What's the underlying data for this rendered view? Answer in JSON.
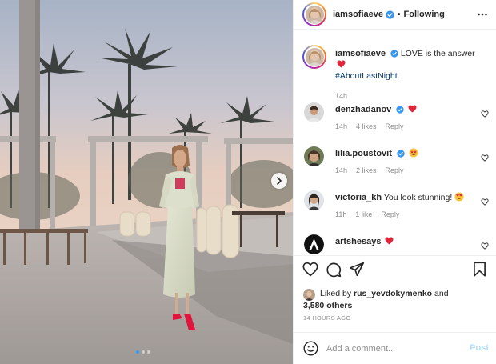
{
  "post": {
    "author": "iamsofiaeve",
    "separator": "•",
    "follow_status": "Following",
    "caption": {
      "text": "LOVE is the answer",
      "hashtag": "#AboutLastNight",
      "time": "14h"
    },
    "carousel": {
      "slides": 3,
      "current": 1
    },
    "likes": {
      "prefix": "Liked by",
      "user": "rus_yevdokymenko",
      "joiner": "and",
      "others": "3,580 others"
    },
    "timestamp": "14 HOURS AGO",
    "add_comment_placeholder": "Add a comment...",
    "post_label": "Post"
  },
  "comments": [
    {
      "user": "denzhadanov",
      "text": "",
      "emoji": "red-heart",
      "time": "14h",
      "likes": "4 likes",
      "reply": "Reply"
    },
    {
      "user": "lilia.poustovit",
      "text": "",
      "emoji": "star-struck",
      "time": "14h",
      "likes": "2 likes",
      "reply": "Reply"
    },
    {
      "user": "victoria_kh",
      "text": "You look stunning!",
      "emoji": "heart-eyes",
      "time": "11h",
      "likes": "1 like",
      "reply": "Reply"
    },
    {
      "user": "artshesays",
      "text": "",
      "emoji": "red-heart",
      "time": "",
      "likes": "",
      "reply": ""
    }
  ],
  "colors": {
    "link": "#00376b",
    "muted": "#8e8e8e",
    "verified": "#3897f0",
    "heart": "#ed4956",
    "post_disabled": "#b2dffc"
  },
  "icons": [
    "more-icon",
    "heart-icon",
    "comment-icon",
    "share-icon",
    "bookmark-icon",
    "emoji-icon",
    "chevron-right-icon",
    "verified-badge-icon"
  ]
}
